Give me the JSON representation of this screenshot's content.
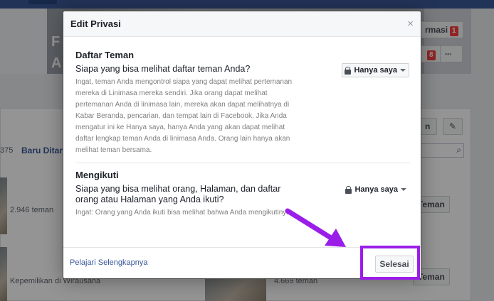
{
  "background": {
    "tabs": {
      "aktivitas": "rmasi",
      "aktivitas_count": "1",
      "messages_count": "8",
      "more": "•••"
    },
    "cover_letters": [
      "F",
      "A"
    ],
    "friend_count_partial": "375",
    "recently_added_link": "Baru Ditar",
    "add_friend_label": "n",
    "friend_cards": [
      {
        "meta": "2.946 teman",
        "button": "Teman"
      },
      {
        "meta": "Kepemilikan di Wirausaha",
        "button": ""
      },
      {
        "meta": "4.669 teman",
        "button": "Teman"
      }
    ]
  },
  "dialog": {
    "title": "Edit Privasi",
    "close_symbol": "×",
    "sections": [
      {
        "title": "Daftar Teman",
        "question": "Siapa yang bisa melihat daftar teman Anda?",
        "description": "Ingat, teman Anda mengontrol siapa yang dapat melihat pertemanan mereka di Linimasa mereka sendiri. Jika orang dapat melihat pertemanan Anda di linimasa lain, mereka akan dapat melihatnya di Kabar Beranda, pencarian, dan tempat lain di Facebook. Jika Anda mengatur ini ke Hanya saya, hanya Anda yang akan dapat melihat daftar lengkap teman Anda di linimasa Anda. Orang lain hanya akan melihat teman bersama.",
        "privacy": "Hanya saya"
      },
      {
        "title": "Mengikuti",
        "question": "Siapa yang bisa melihat orang, Halaman, dan daftar orang atau Halaman yang Anda ikuti?",
        "description": "Ingat: Orang yang Anda ikuti bisa melihat bahwa Anda mengikutinya.",
        "privacy": "Hanya saya"
      }
    ],
    "learn_more": "Pelajari Selengkapnya",
    "done_label": "Selesai"
  },
  "icons": {
    "lock": "lock-icon",
    "dropdown": "chevron-down-icon",
    "close": "close-icon",
    "search": "search-icon",
    "edit": "pencil-icon"
  },
  "colors": {
    "highlight": "#9b1ee8",
    "facebook_blue": "#3b5998",
    "link": "#365899"
  }
}
